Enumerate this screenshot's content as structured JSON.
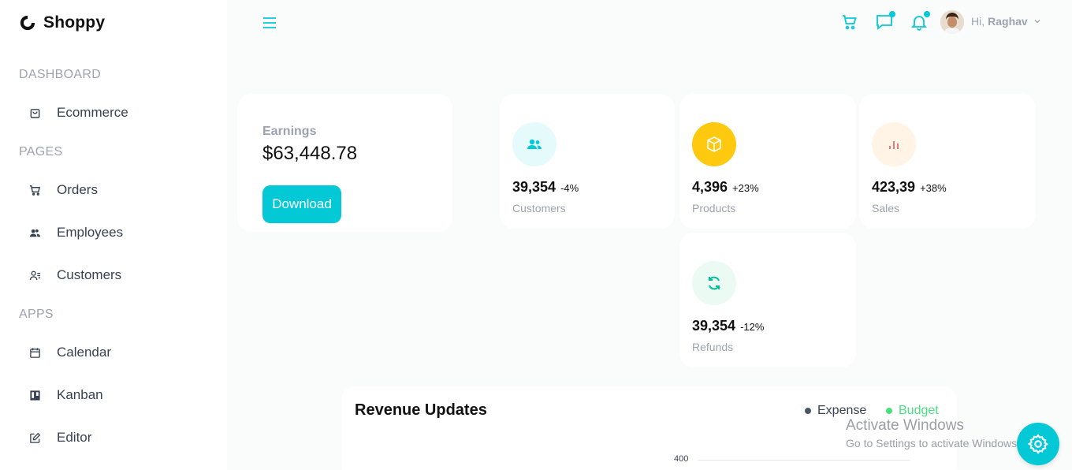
{
  "brand": {
    "name": "Shoppy"
  },
  "sidebar": {
    "sections": [
      {
        "title": "DASHBOARD"
      },
      {
        "title": "PAGES"
      },
      {
        "title": "APPS"
      }
    ],
    "items": [
      {
        "label": "Ecommerce",
        "icon": "shopping-bag-icon"
      },
      {
        "label": "Orders",
        "icon": "cart-icon"
      },
      {
        "label": "Employees",
        "icon": "employees-icon"
      },
      {
        "label": "Customers",
        "icon": "customers-icon"
      },
      {
        "label": "Calendar",
        "icon": "calendar-icon"
      },
      {
        "label": "Kanban",
        "icon": "kanban-icon"
      },
      {
        "label": "Editor",
        "icon": "edit-icon"
      }
    ]
  },
  "topbar": {
    "greeting": "Hi,",
    "user_name": "Raghav"
  },
  "earnings": {
    "label": "Earnings",
    "value": "$63,448.78",
    "button_label": "Download"
  },
  "stats": [
    {
      "amount": "39,354",
      "percentage": "-4%",
      "title": "Customers",
      "icon": "customers-icon",
      "icon_color": "#03c9d7",
      "icon_bg": "#e5fafb",
      "pct_color": "#111"
    },
    {
      "amount": "4,396",
      "percentage": "+23%",
      "title": "Products",
      "icon": "box-icon",
      "icon_color": "#ffffff",
      "icon_bg": "#fec90f",
      "pct_color": "#111"
    },
    {
      "amount": "423,39",
      "percentage": "+38%",
      "title": "Sales",
      "icon": "bar-chart-icon",
      "icon_color": "#e46a76",
      "icon_bg": "#fff4e5",
      "pct_color": "#111"
    },
    {
      "amount": "39,354",
      "percentage": "-12%",
      "title": "Refunds",
      "icon": "refresh-icon",
      "icon_color": "#00c292",
      "icon_bg": "#ebfaf2",
      "pct_color": "#111"
    }
  ],
  "revenue": {
    "title": "Revenue Updates",
    "legend": [
      {
        "label": "Expense",
        "color": "#4b5563"
      },
      {
        "label": "Budget",
        "color": "#4ade80"
      }
    ],
    "axis_tick": "400"
  },
  "watermark": {
    "title": "Activate Windows",
    "subtitle": "Go to Settings to activate Windows."
  },
  "colors": {
    "accent": "#03c9d7"
  }
}
